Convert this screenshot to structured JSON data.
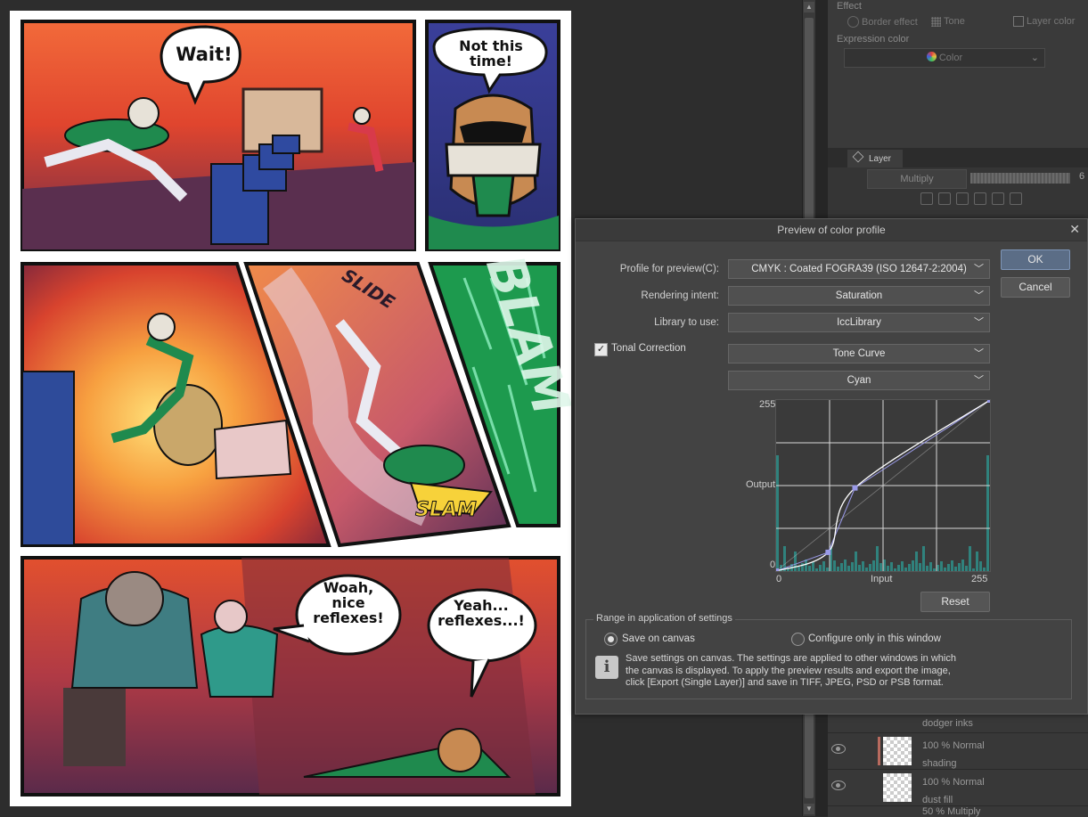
{
  "comic": {
    "speech": [
      "Wait!",
      "Not this time!",
      "Woah,\nnice\nreflexes!",
      "Yeah...\nreflexes...!"
    ],
    "sfx": [
      "SLIDE",
      "SLAM",
      "BLAM"
    ]
  },
  "props_panel": {
    "effect_label": "Effect",
    "effect_options": [
      "Border effect",
      "Tone",
      "Layer color"
    ],
    "expression_label": "Expression color",
    "expression_value": "Color"
  },
  "layer_panel": {
    "tab_label": "Layer",
    "blend_mode": "Multiply",
    "opacity_partial": "6",
    "layers": [
      {
        "mode": "",
        "name": "dodger inks"
      },
      {
        "mode": "100 % Normal",
        "name": "shading"
      },
      {
        "mode": "100 % Normal",
        "name": "dust fill"
      },
      {
        "mode": "50 % Multiply",
        "name": ""
      }
    ]
  },
  "dialog": {
    "title": "Preview of color profile",
    "profile_label": "Profile for preview(C):",
    "profile_value": "CMYK : Coated FOGRA39 (ISO 12647-2:2004)",
    "intent_label": "Rendering intent:",
    "intent_value": "Saturation",
    "library_label": "Library to use:",
    "library_value": "IccLibrary",
    "tonal_label": "Tonal Correction",
    "tonal_checked": true,
    "curve_type": "Tone Curve",
    "channel": "Cyan",
    "ok_label": "OK",
    "cancel_label": "Cancel",
    "reset_label": "Reset",
    "graph": {
      "y_max": "255",
      "y_label": "Output",
      "y_min": "0",
      "x_min": "0",
      "x_label": "Input",
      "x_max": "255",
      "control_points": [
        [
          0,
          0
        ],
        [
          62,
          28
        ],
        [
          94,
          124
        ],
        [
          255,
          255
        ]
      ]
    },
    "range_title": "Range in application of settings",
    "radio_canvas": "Save on canvas",
    "radio_window": "Configure only in this window",
    "selected_range": "canvas",
    "info": "Save settings on canvas. The settings are applied to other windows in which the canvas is displayed. To apply the preview results and export the image, click [Export (Single Layer)] and save in TIFF, JPEG, PSD or PSB format."
  },
  "colors": {
    "accent_button": "#5b6d86",
    "histogram": "#2f8f8a",
    "curve_points": "#9a9ae8"
  }
}
